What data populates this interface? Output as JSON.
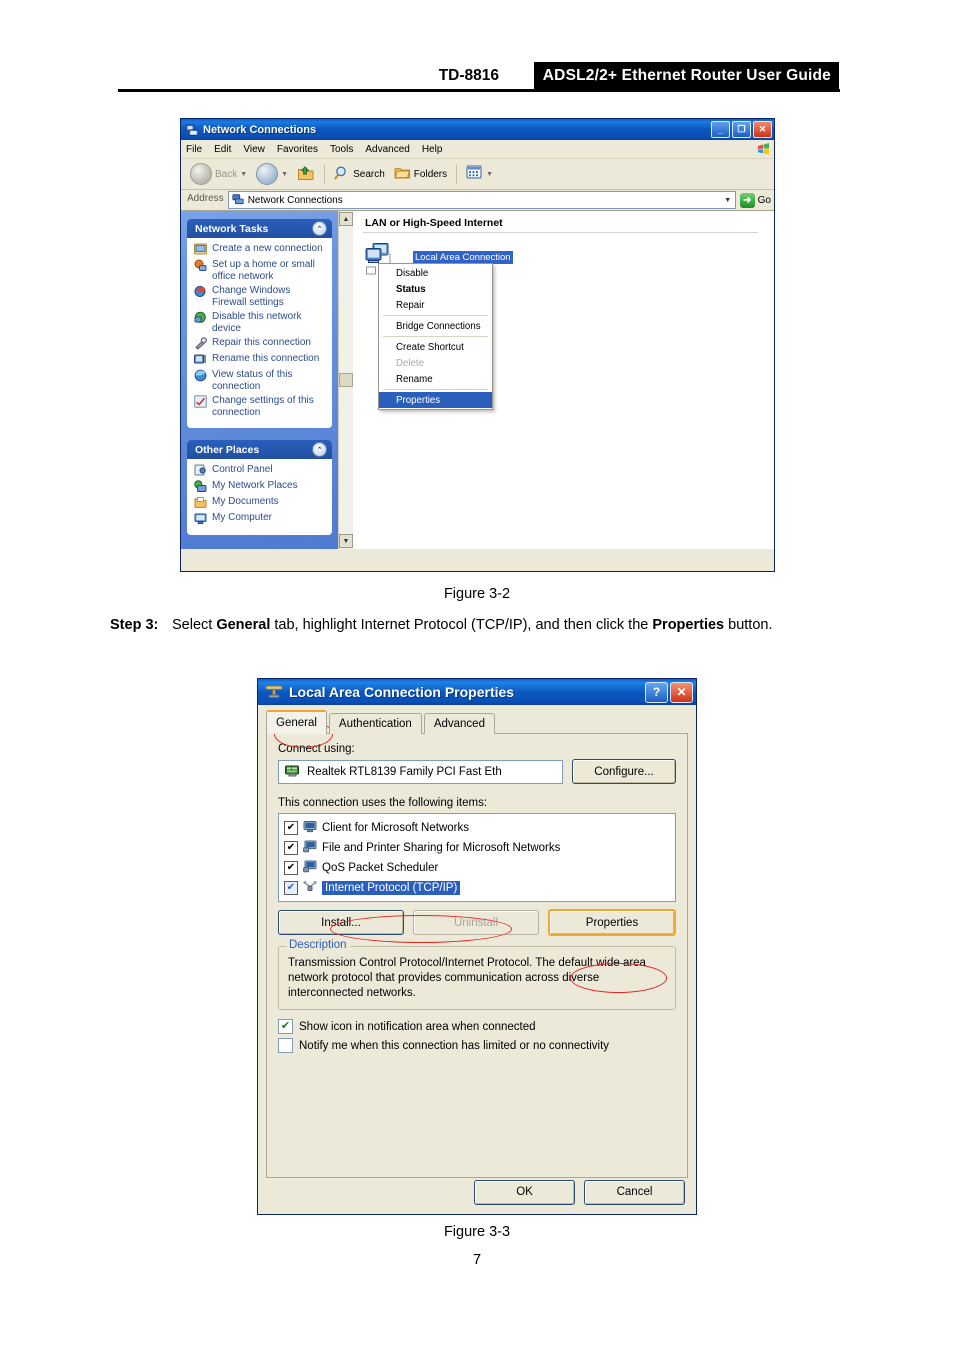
{
  "page": {
    "header": {
      "model": "TD-8816",
      "title": "ADSL2/2+  Ethernet  Router  User  Guide"
    },
    "figure_2_caption": "Figure 3-2",
    "figure_3_caption": "Figure 3-3",
    "page_number": "7",
    "step": {
      "label": "Step 3:",
      "text_1": "Select ",
      "bold_1": "General",
      "text_2": " tab, highlight Internet Protocol (TCP/IP), and then click the ",
      "bold_2": "Properties",
      "text_3": " button."
    }
  },
  "network_connections": {
    "title": "Network Connections",
    "title_icon": "network-connections-icon",
    "window_buttons": {
      "minimize": "_",
      "maximize": "❐",
      "close": "✕"
    },
    "menu": [
      "File",
      "Edit",
      "View",
      "Favorites",
      "Tools",
      "Advanced",
      "Help"
    ],
    "toolbar": {
      "back": "Back",
      "forward": "",
      "up": "",
      "search": "Search",
      "folders": "Folders",
      "views": ""
    },
    "address": {
      "label": "Address",
      "value": "Network Connections",
      "go": "Go"
    },
    "panels": [
      {
        "title": "Network Tasks",
        "items": [
          {
            "label": "Create a new connection",
            "icon": "new-connection-icon"
          },
          {
            "label": "Set up a home or small office network",
            "icon": "home-network-icon"
          },
          {
            "label": "Change Windows Firewall settings",
            "icon": "firewall-icon"
          },
          {
            "label": "Disable this network device",
            "icon": "disable-device-icon"
          },
          {
            "label": "Repair this connection",
            "icon": "repair-icon"
          },
          {
            "label": "Rename this connection",
            "icon": "rename-icon"
          },
          {
            "label": "View status of this connection",
            "icon": "status-icon"
          },
          {
            "label": "Change settings of this connection",
            "icon": "settings-icon"
          }
        ]
      },
      {
        "title": "Other Places",
        "items": [
          {
            "label": "Control Panel",
            "icon": "control-panel-icon"
          },
          {
            "label": "My Network Places",
            "icon": "network-places-icon"
          },
          {
            "label": "My Documents",
            "icon": "documents-icon"
          },
          {
            "label": "My Computer",
            "icon": "my-computer-icon"
          }
        ]
      }
    ],
    "content": {
      "group_heading": "LAN or High-Speed Internet",
      "connection_name": "Local Area Connection"
    },
    "context_menu": [
      {
        "label": "Disable",
        "style": "normal"
      },
      {
        "label": "Status",
        "style": "bold"
      },
      {
        "label": "Repair",
        "style": "normal"
      },
      {
        "label": "Bridge Connections",
        "style": "normal"
      },
      {
        "label": "Create Shortcut",
        "style": "normal"
      },
      {
        "label": "Delete",
        "style": "disabled"
      },
      {
        "label": "Rename",
        "style": "normal"
      },
      {
        "label": "Properties",
        "style": "selected"
      }
    ]
  },
  "lac_dialog": {
    "title": "Local Area Connection Properties",
    "title_icon": "network-adapter-icon",
    "help_button": "?",
    "close_button": "✕",
    "tabs": [
      {
        "label": "General",
        "active": true
      },
      {
        "label": "Authentication",
        "active": false
      },
      {
        "label": "Advanced",
        "active": false
      }
    ],
    "connect_using_label": "Connect using:",
    "adapter": "Realtek RTL8139 Family PCI Fast Eth",
    "configure_button": "Configure...",
    "items_label_pre": "This c",
    "items_label_u": "o",
    "items_label_post": "nnection uses the following items:",
    "items_label": "This connection uses the following items:",
    "items": [
      {
        "label": "Client for Microsoft Networks",
        "checked": true,
        "selected": false,
        "icon": "client-service-icon"
      },
      {
        "label": "File and Printer Sharing for Microsoft Networks",
        "checked": true,
        "selected": false,
        "icon": "file-sharing-icon"
      },
      {
        "label": "QoS Packet Scheduler",
        "checked": true,
        "selected": false,
        "icon": "qos-service-icon"
      },
      {
        "label": "Internet Protocol (TCP/IP)",
        "checked": true,
        "selected": true,
        "icon": "protocol-icon"
      }
    ],
    "buttons": {
      "install": "Install...",
      "uninstall": "Uninstall",
      "properties": "Properties"
    },
    "description": {
      "legend": "Description",
      "text": "Transmission Control Protocol/Internet Protocol. The default wide area network protocol that provides communication across diverse interconnected networks."
    },
    "options": [
      {
        "label": "Show icon in notification area when connected",
        "checked": true
      },
      {
        "label": "Notify me when this connection has limited or no connectivity",
        "checked": false
      }
    ],
    "footer": {
      "ok": "OK",
      "cancel": "Cancel"
    }
  },
  "colors": {
    "title_blue": "#0a57c0",
    "selection_blue": "#2b5fbd",
    "annotation_red": "#e8241f",
    "highlight_orange": "#f0a830",
    "dialog_face": "#ece9d8"
  }
}
